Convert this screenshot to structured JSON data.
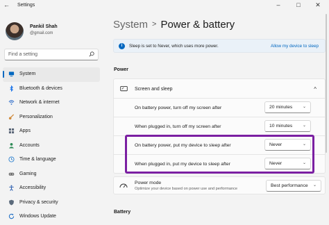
{
  "window": {
    "title": "Settings",
    "back_glyph": "←",
    "minimize_glyph": "–",
    "maximize_glyph": "□",
    "close_glyph": "✕"
  },
  "user": {
    "name": "Pankil Shah",
    "email": "@gmail.com"
  },
  "search": {
    "placeholder": "Find a setting",
    "icon": "search-icon"
  },
  "sidebar": {
    "items": [
      {
        "label": "System",
        "icon": "system-icon",
        "color": "#0067c0",
        "active": true
      },
      {
        "label": "Bluetooth & devices",
        "icon": "bluetooth-icon",
        "color": "#1a73e8"
      },
      {
        "label": "Network & internet",
        "icon": "wifi-icon",
        "color": "#2b6bc9"
      },
      {
        "label": "Personalization",
        "icon": "brush-icon",
        "color": "#d08a3a"
      },
      {
        "label": "Apps",
        "icon": "apps-icon",
        "color": "#5a6677"
      },
      {
        "label": "Accounts",
        "icon": "person-icon",
        "color": "#2e8b57"
      },
      {
        "label": "Time & language",
        "icon": "globe-clock-icon",
        "color": "#2a7fcf"
      },
      {
        "label": "Gaming",
        "icon": "controller-icon",
        "color": "#6b6b6b"
      },
      {
        "label": "Accessibility",
        "icon": "accessibility-icon",
        "color": "#2d5fb0"
      },
      {
        "label": "Privacy & security",
        "icon": "shield-icon",
        "color": "#5b6a7b"
      },
      {
        "label": "Windows Update",
        "icon": "update-icon",
        "color": "#1f6fc5"
      }
    ]
  },
  "breadcrumb": {
    "parent": "System",
    "separator": ">",
    "current": "Power & battery"
  },
  "infobar": {
    "text": "Sleep is set to Never, which uses more power.",
    "link": "Allow my device to sleep",
    "icon_glyph": "i"
  },
  "power_section": {
    "label": "Power",
    "screen_sleep": {
      "title": "Screen and sleep",
      "chevron_glyph": "^",
      "rows": [
        {
          "label": "On battery power, turn off my screen after",
          "value": "20 minutes"
        },
        {
          "label": "When plugged in, turn off my screen after",
          "value": "10 minutes"
        },
        {
          "label": "On battery power, put my device to sleep after",
          "value": "Never"
        },
        {
          "label": "When plugged in, put my device to sleep after",
          "value": "Never"
        }
      ]
    },
    "power_mode": {
      "title": "Power mode",
      "subtitle": "Optimize your device based on power use and performance",
      "value": "Best performance"
    }
  },
  "battery_section": {
    "label": "Battery"
  },
  "dropdown_chevron_glyph": "⌄",
  "colors": {
    "accent": "#0067c0",
    "highlight": "#7b1fa2",
    "infobar_bg": "#eaf1f8"
  }
}
